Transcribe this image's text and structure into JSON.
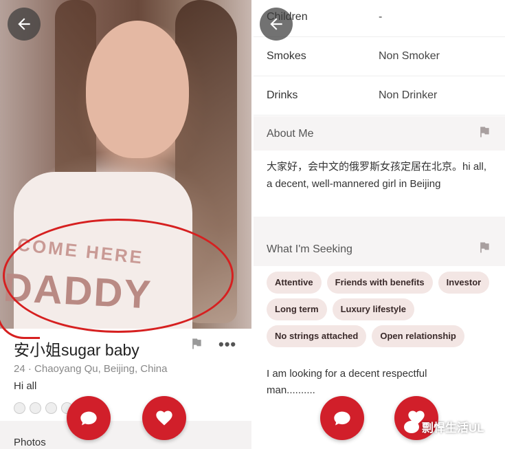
{
  "left": {
    "shirt_line1": "COME HERE",
    "shirt_line2": "DADDY",
    "name": "安小姐sugar baby",
    "age": "24",
    "location": "· Chaoyang Qu, Beijing, China",
    "bio": "Hi all",
    "more": "•••",
    "photos_label": "Photos"
  },
  "right": {
    "rows": [
      {
        "label": "Children",
        "value": "-"
      },
      {
        "label": "Smokes",
        "value": "Non Smoker"
      },
      {
        "label": "Drinks",
        "value": "Non Drinker"
      }
    ],
    "about_title": "About Me",
    "about_text": "大家好，会中文的俄罗斯女孩定居在北京。hi all, a decent,  well-mannered girl in Beijing",
    "seeking_title": "What I'm Seeking",
    "chips": [
      "Attentive",
      "Friends with benefits",
      "Investor",
      "Long term",
      "Luxury lifestyle",
      "No strings attached",
      "Open relationship"
    ],
    "seeking_text": "I am looking for a decent  respectful man.........."
  },
  "watermark": "剽悍生活UL",
  "colors": {
    "accent": "#d11f2a",
    "chip_bg": "#f3e6e4",
    "section_bg": "#f6f4f4",
    "annotation": "#d62020"
  },
  "icons": [
    "back-arrow-icon",
    "flag-icon",
    "more-icon",
    "chat-icon",
    "heart-icon"
  ]
}
